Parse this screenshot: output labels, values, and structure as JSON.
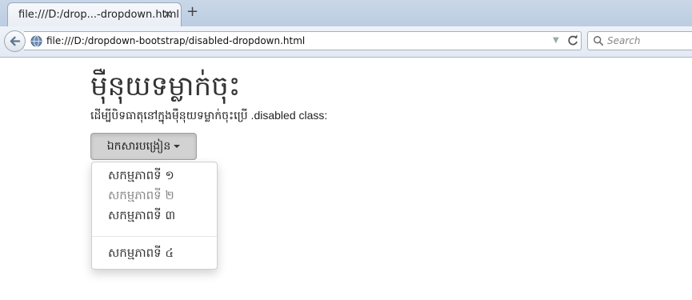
{
  "browser": {
    "tab_title": "file:///D:/drop...-dropdown.html",
    "tab_close": "✕",
    "new_tab": "+",
    "url": "file:///D:/dropdown-bootstrap/disabled-dropdown.html",
    "search_placeholder": "Search"
  },
  "page": {
    "title": "ម៉ឺនុយទម្លាក់ចុះ",
    "description": "ដើម្បីបិទធាតុនៅក្នុងម៉ឺនុយទម្លាក់ចុះប្រើ .disabled class:",
    "dropdown_label": "ឯកសារបង្រៀន",
    "menu_items": [
      {
        "label": "សកម្មភាពទី ១",
        "disabled": false
      },
      {
        "label": "សកម្មភាពទី ២",
        "disabled": true
      },
      {
        "label": "សកម្មភាពទី ៣",
        "disabled": false
      },
      {
        "label": "សកម្មភាពទី ៤",
        "disabled": false
      }
    ]
  },
  "colors": {
    "accent_disabled": "#888888",
    "button_bg": "#d2d2d2"
  }
}
